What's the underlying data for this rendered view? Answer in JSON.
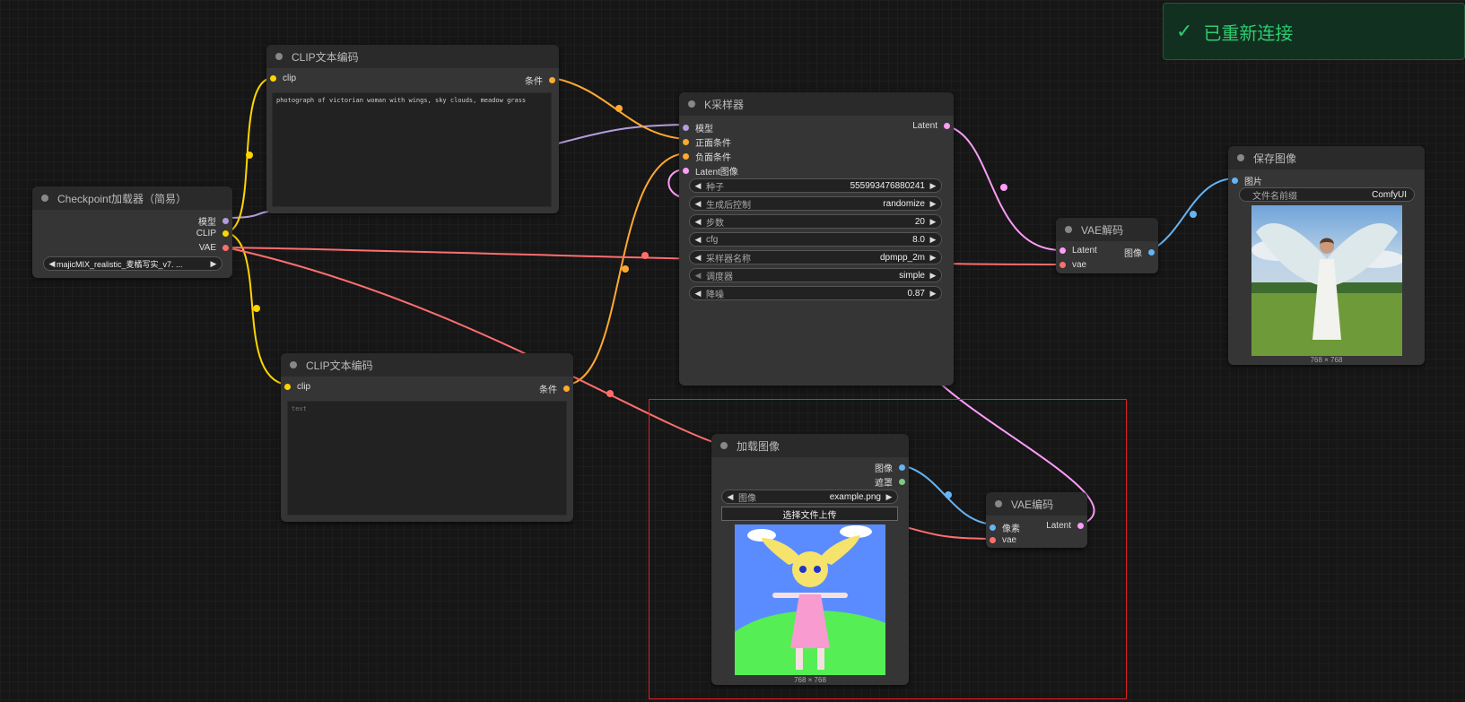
{
  "colors": {
    "model": "#b39ddb",
    "clip": "#ffd500",
    "conditioning": "#ffa931",
    "latent": "#ff9cf9",
    "vae": "#ff6e6e",
    "image": "#64b5f6",
    "mask": "#81c784",
    "toast_bg": "#12301f",
    "toast_text": "#2ecc71",
    "selection": "#e02020"
  },
  "toast": {
    "icon": "check-icon",
    "text": "已重新连接"
  },
  "nodes": {
    "checkpoint": {
      "title": "Checkpoint加载器（简易）",
      "outputs": [
        "模型",
        "CLIP",
        "VAE"
      ],
      "ckpt_value": "majicMIX_realistic_麦橘写实_v7. ..."
    },
    "clip_pos": {
      "title": "CLIP文本编码",
      "input": "clip",
      "output": "条件",
      "text": "photograph of victorian woman with wings, sky clouds, meadow grass"
    },
    "clip_neg": {
      "title": "CLIP文本编码",
      "input": "clip",
      "output": "条件",
      "placeholder": "text"
    },
    "ksampler": {
      "title": "K采样器",
      "inputs": [
        "模型",
        "正面条件",
        "负面条件",
        "Latent图像"
      ],
      "output": "Latent",
      "widgets": [
        {
          "label": "种子",
          "value": "555993476880241"
        },
        {
          "label": "生成后控制",
          "value": "randomize"
        },
        {
          "label": "步数",
          "value": "20"
        },
        {
          "label": "cfg",
          "value": "8.0"
        },
        {
          "label": "采样器名称",
          "value": "dpmpp_2m"
        },
        {
          "label": "调度器",
          "value": "simple"
        },
        {
          "label": "降噪",
          "value": "0.87"
        }
      ]
    },
    "vae_decode": {
      "title": "VAE解码",
      "inputs": [
        "Latent",
        "vae"
      ],
      "output": "图像"
    },
    "save_image": {
      "title": "保存图像",
      "input": "图片",
      "widget": {
        "label": "文件名前缀",
        "value": "ComfyUI"
      },
      "image_size": "768 × 768"
    },
    "load_image": {
      "title": "加载图像",
      "outputs": [
        "图像",
        "遮罩"
      ],
      "widget": {
        "label": "图像",
        "value": "example.png"
      },
      "upload_button": "选择文件上传",
      "image_size": "768 × 768"
    },
    "vae_encode": {
      "title": "VAE编码",
      "inputs": [
        "像素",
        "vae"
      ],
      "output": "Latent"
    }
  }
}
